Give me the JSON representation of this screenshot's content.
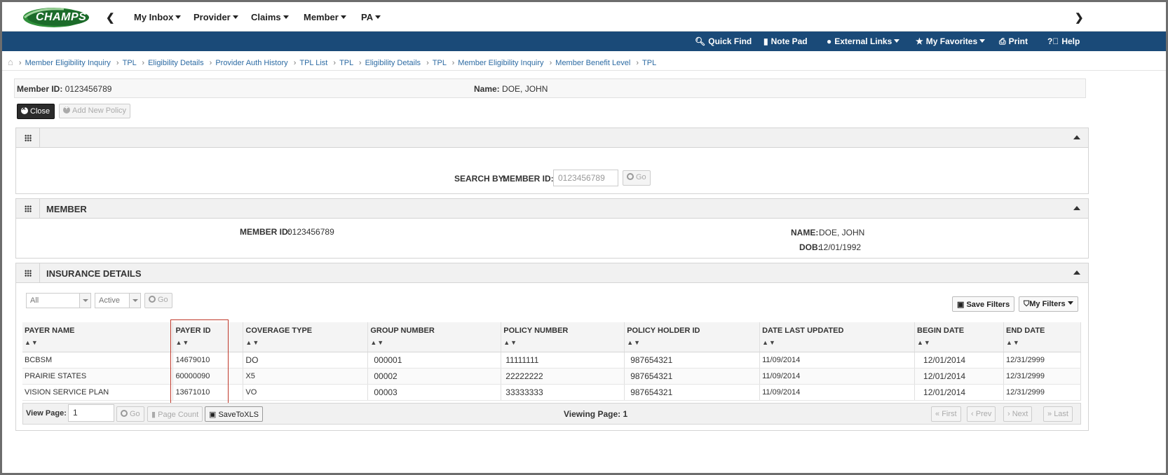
{
  "app": {
    "logo_text": "CHAMPS",
    "menu": [
      "My Inbox",
      "Provider",
      "Claims",
      "Member",
      "PA"
    ]
  },
  "toolbar": {
    "quick_find": "Quick Find",
    "note_pad": "Note Pad",
    "external_links": "External Links",
    "my_favorites": "My Favorites",
    "print": "Print",
    "help": "Help"
  },
  "breadcrumb": [
    "Member Eligibility Inquiry",
    "TPL",
    "Eligibility Details",
    "Provider Auth History",
    "TPL List",
    "TPL",
    "Eligibility Details",
    "TPL",
    "Member Eligibility Inquiry",
    "Member Benefit Level",
    "TPL"
  ],
  "header": {
    "member_id_label": "Member ID:",
    "member_id_value": "0123456789",
    "name_label": "Name:",
    "name_value": "DOE, JOHN"
  },
  "actions": {
    "close_label": "Close",
    "add_policy_label": "Add New Policy"
  },
  "search_panel": {
    "search_by_label": "SEARCH BY:",
    "member_id_label": "MEMBER ID:",
    "member_id_placeholder": "0123456789",
    "go_label": "Go"
  },
  "member_panel": {
    "title": "MEMBER",
    "member_id_label": "MEMBER ID:",
    "member_id_value": "0123456789",
    "name_label": "NAME:",
    "name_value": "DOE, JOHN",
    "dob_label": "DOB:",
    "dob_value": "12/01/1992"
  },
  "insurance_panel": {
    "title": "INSURANCE DETAILS",
    "filter1_value": "All",
    "filter2_value": "Active",
    "go_label": "Go",
    "save_filters_label": "Save Filters",
    "my_filters_label": "My Filters",
    "columns": [
      "PAYER NAME",
      "PAYER ID",
      "COVERAGE TYPE",
      "GROUP NUMBER",
      "POLICY NUMBER",
      "POLICY HOLDER ID",
      "DATE LAST UPDATED",
      "BEGIN DATE",
      "END DATE"
    ],
    "sort_glyph": "▲▼",
    "rows": [
      [
        "BCBSM",
        "14679010",
        "DO",
        "000001",
        "11111111",
        "987654321",
        "11/09/2014",
        "12/01/2014",
        "12/31/2999"
      ],
      [
        "PRAIRIE STATES",
        "60000090",
        "X5",
        "00002",
        "22222222",
        "987654321",
        "11/09/2014",
        "12/01/2014",
        "12/31/2999"
      ],
      [
        "VISION SERVICE PLAN",
        "13671010",
        "VO",
        "00003",
        "33333333",
        "987654321",
        "11/09/2014",
        "12/01/2014",
        "12/31/2999"
      ]
    ],
    "footer": {
      "view_page_label": "View Page:",
      "view_page_value": "1",
      "go_label": "Go",
      "page_count_label": "Page Count",
      "save_xls_label": "SaveToXLS",
      "viewing_label": "Viewing Page: 1",
      "first_label": "First",
      "prev_label": "Prev",
      "next_label": "Next",
      "last_label": "Last"
    }
  }
}
